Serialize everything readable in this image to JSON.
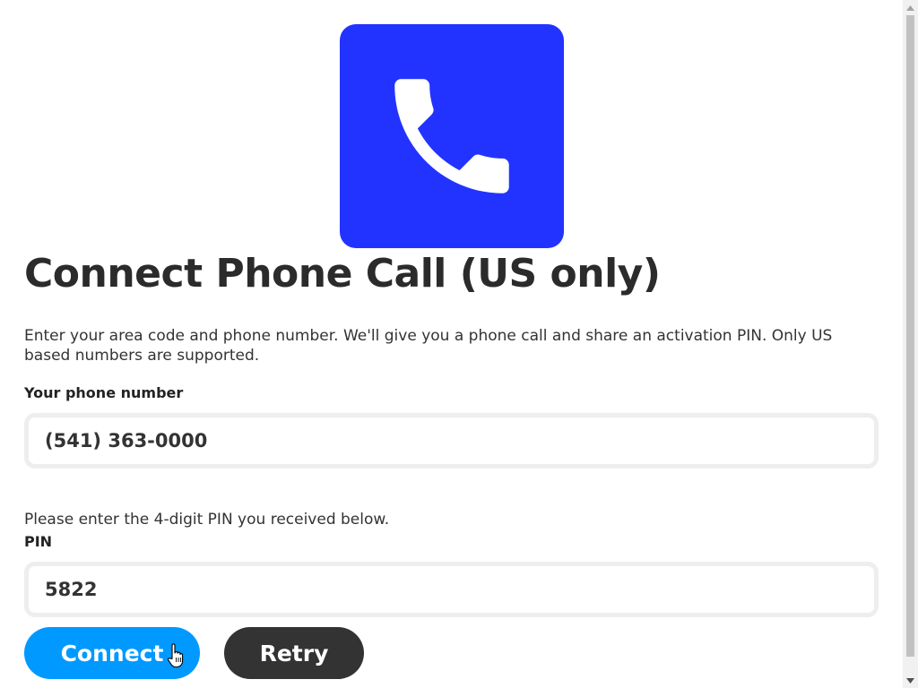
{
  "logo": {
    "icon": "phone-icon",
    "background": "#2233ff"
  },
  "title": "Connect Phone Call (US only)",
  "description": "Enter your area code and phone number. We'll give you a phone call and share an activation PIN. Only US based numbers are supported.",
  "phone": {
    "label": "Your phone number",
    "value": "(541) 363-0000"
  },
  "pin": {
    "hint": "Please enter the 4-digit PIN you received below.",
    "label": "PIN",
    "value": "5822"
  },
  "buttons": {
    "connect": "Connect",
    "retry": "Retry"
  },
  "colors": {
    "connect": "#0099ff",
    "retry": "#333333",
    "brand": "#2233ff"
  }
}
